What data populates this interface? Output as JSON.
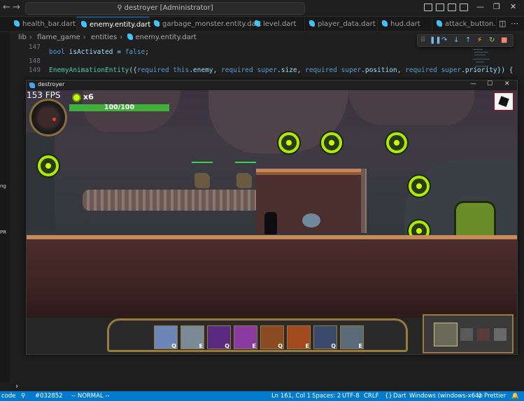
{
  "vscode": {
    "title": "destroyer [Administrator]",
    "tabs": [
      {
        "label": "health_bar.dart"
      },
      {
        "label": "enemy.entity.dart",
        "active": true
      },
      {
        "label": "garbage_monster.entity.dart"
      },
      {
        "label": "level.dart"
      },
      {
        "label": "player_data.dart"
      },
      {
        "label": "hud.dart"
      },
      {
        "label": "attack_button.da"
      }
    ],
    "breadcrumb": [
      "lib",
      "flame_game",
      "entities",
      "enemy.entity.dart"
    ],
    "code": {
      "line_numbers": [
        "147",
        "148",
        "149"
      ],
      "line147": {
        "kw": "bool",
        "rest": " isActivated = ",
        "lit": "false",
        "end": ";"
      },
      "line149": {
        "fn": "EnemyAnimationEntity",
        "p1": "({",
        "k1": "required this",
        "a1": ".enemy, ",
        "k2": "required super",
        "a2": ".size, ",
        "k3": "required super",
        "a3": ".position, ",
        "k4": "required super",
        "a4": ".priority}) {"
      }
    },
    "left_rail": {
      "label_a": "ng",
      "label_b": "PR",
      "label_c": "code"
    },
    "statusbar": {
      "remote": "code",
      "branch": "#032852",
      "mode": "-- NORMAL --",
      "position": "Ln 161, Col 1",
      "spaces": "Spaces: 2",
      "encoding": "UTF-8",
      "eol": "CRLF",
      "language": "Dart",
      "platform": "Windows (windows-x64)",
      "prettier": "Prettier"
    }
  },
  "game_window": {
    "title": "destroyer",
    "fps": "153 FPS",
    "coins": "x6",
    "health": "100/100",
    "health_fraction": 1.0,
    "skill_keys": [
      "Q",
      "E",
      "Q",
      "E",
      "Q",
      "E",
      "Q",
      "E"
    ]
  },
  "icons": {
    "search": "search-icon",
    "dart": "dart-file-icon",
    "debug": [
      "drag-handle-icon",
      "pause-icon",
      "step-over-icon",
      "step-into-icon",
      "step-out-icon",
      "hot-reload-icon",
      "restart-icon",
      "stop-icon"
    ]
  },
  "colors": {
    "accent": "#007acc",
    "health": "#3fb03a",
    "coin": "#c6ff00"
  }
}
